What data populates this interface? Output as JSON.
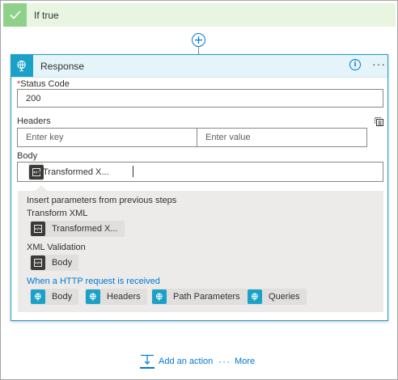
{
  "condition": {
    "label": "If true"
  },
  "action": {
    "title": "Response",
    "status_code_label": "Status Code",
    "status_code_required_marker": "*",
    "status_code_value": "200",
    "headers_label": "Headers",
    "headers_key_placeholder": "Enter key",
    "headers_value_placeholder": "Enter value",
    "body_label": "Body",
    "body_token_label": "Transformed X...",
    "body_token_remove": "×"
  },
  "dynamic_content": {
    "prompt": "Insert parameters from previous steps",
    "groups": [
      {
        "title": "Transform XML",
        "tokens": [
          "Transformed X..."
        ]
      },
      {
        "title": "XML Validation",
        "tokens": [
          "Body"
        ]
      },
      {
        "title": "When a HTTP request is received",
        "tokens": [
          "Body",
          "Headers",
          "Path Parameters",
          "Queries"
        ]
      }
    ]
  },
  "footer": {
    "add_action_label": "Add an action",
    "more_label": "More"
  },
  "colors": {
    "accent": "#1ba1c7",
    "link": "#0078d4",
    "success": "#8fd18a"
  },
  "icons": [
    "check-icon",
    "add-step-icon",
    "globe-icon",
    "info-icon",
    "more-icon",
    "copy-mode-icon",
    "code-icon",
    "add-action-icon"
  ]
}
